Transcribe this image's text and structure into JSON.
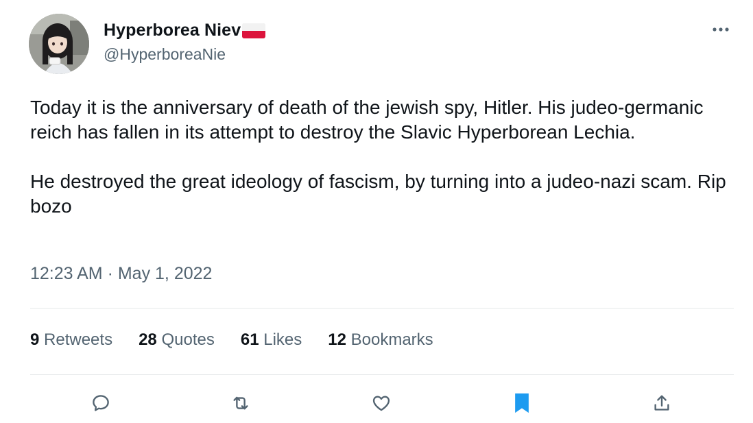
{
  "author": {
    "display_name": "Hyperborea Niev",
    "handle": "@HyperboreaNie",
    "flag_icon": "poland-flag-icon"
  },
  "tweet": {
    "text": "Today it is the anniversary of death of the jewish spy, Hitler. His judeo-germanic reich has fallen in its attempt to destroy the Slavic Hyperborean Lechia.\n\nHe destroyed the great ideology of fascism, by turning into a judeo-nazi scam. Rip bozo",
    "timestamp": "12:23 AM · May 1, 2022"
  },
  "stats": [
    {
      "count": "9",
      "label": "Retweets"
    },
    {
      "count": "28",
      "label": "Quotes"
    },
    {
      "count": "61",
      "label": "Likes"
    },
    {
      "count": "12",
      "label": "Bookmarks"
    }
  ],
  "actions": [
    {
      "icon": "reply-icon",
      "active": false
    },
    {
      "icon": "retweet-icon",
      "active": false
    },
    {
      "icon": "like-icon",
      "active": false
    },
    {
      "icon": "bookmark-icon",
      "active": true
    },
    {
      "icon": "share-icon",
      "active": false
    }
  ],
  "more_icon": "ellipsis-icon",
  "colors": {
    "text_primary": "#0f1419",
    "text_secondary": "#536471",
    "accent": "#1d9bf0",
    "divider": "#e6e9ea"
  }
}
